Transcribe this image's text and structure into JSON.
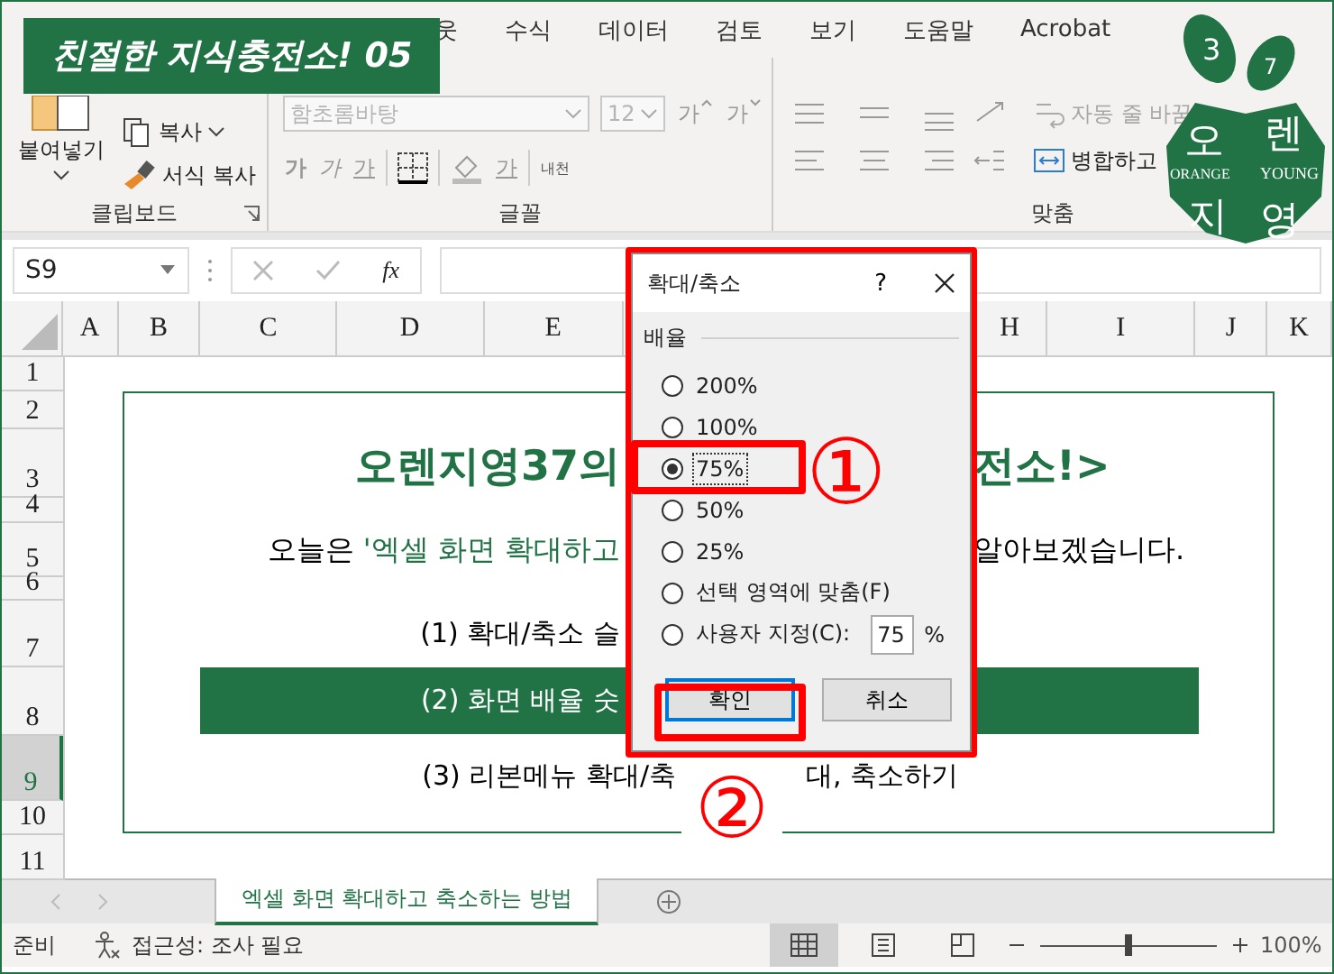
{
  "banner": {
    "text": "친절한 지식충전소! 05"
  },
  "ribbon_tabs": [
    {
      "label": "웃"
    },
    {
      "label": "수식"
    },
    {
      "label": "데이터"
    },
    {
      "label": "검토"
    },
    {
      "label": "보기"
    },
    {
      "label": "도움말"
    },
    {
      "label": "Acrobat"
    }
  ],
  "ribbon": {
    "clipboard": {
      "paste": "붙여넣기",
      "copy": {
        "label": "복사",
        "disabled": false
      },
      "format_painter": {
        "label": "서식 복사",
        "disabled": false
      },
      "group": "클립보드"
    },
    "font": {
      "font_name": {
        "label": "함초롬바탕",
        "disabled": true
      },
      "font_size": {
        "label": "12",
        "disabled": true
      },
      "grow": "가",
      "shrink": "가",
      "bold": "가",
      "italic": "가",
      "underline": "가",
      "font_color": "가",
      "phonetic": "내천",
      "group": "글꼴"
    },
    "alignment": {
      "wrap_text": {
        "label": "자동 줄 바꿈",
        "disabled": true
      },
      "merge": {
        "label": "병합하고",
        "disabled": false
      },
      "group": "맞춤"
    }
  },
  "logo": {
    "texts": [
      "3",
      "7",
      "오",
      "렌",
      "ORANGE",
      "YOUNG",
      "지",
      "영"
    ]
  },
  "formula_bar": {
    "name_box": "S9",
    "fx": "fx"
  },
  "columns": [
    {
      "label": "A"
    },
    {
      "label": "B"
    },
    {
      "label": "C"
    },
    {
      "label": "D"
    },
    {
      "label": "E"
    },
    {
      "label": "H"
    },
    {
      "label": "I"
    },
    {
      "label": "J"
    },
    {
      "label": "K"
    }
  ],
  "rows": [
    {
      "label": "1",
      "selected": false
    },
    {
      "label": "2",
      "selected": false
    },
    {
      "label": "3",
      "selected": false
    },
    {
      "label": "4",
      "selected": false
    },
    {
      "label": "5",
      "selected": false
    },
    {
      "label": "6",
      "selected": false
    },
    {
      "label": "7",
      "selected": false
    },
    {
      "label": "8",
      "selected": false
    },
    {
      "label": "9",
      "selected": true
    },
    {
      "label": "10",
      "selected": false
    },
    {
      "label": "11",
      "selected": false
    }
  ],
  "content": {
    "title_left": "오렌지영37의",
    "title_right": "전소!>",
    "intro_plain": "오늘은",
    "intro_quote": "'엑셀 화면 확대하고",
    "intro_right": "알아보겠습니다.",
    "items": [
      {
        "kind": "plain",
        "left": "(1) 확대/축소 슬"
      },
      {
        "kind": "highlight",
        "left": "(2) 화면 배율 숫"
      },
      {
        "kind": "plain",
        "left": "(3) 리본메뉴 확대/축",
        "right": "대, 축소하기"
      }
    ]
  },
  "dialog": {
    "title": "확대/축소",
    "help": "?",
    "group": "배율",
    "options": [
      {
        "kind": "preset",
        "label": "200%",
        "selected": false
      },
      {
        "kind": "preset",
        "label": "100%",
        "selected": false
      },
      {
        "kind": "preset",
        "label": "75%",
        "selected": true
      },
      {
        "kind": "preset",
        "label": "50%",
        "selected": false
      },
      {
        "kind": "preset",
        "label": "25%",
        "selected": false
      },
      {
        "kind": "preset",
        "label": "선택 영역에 맞춤(F)",
        "selected": false
      },
      {
        "kind": "custom",
        "label": "사용자 지정(C):",
        "selected": false
      }
    ],
    "custom_value": "75",
    "percent": "%",
    "ok": "확인",
    "cancel": "취소"
  },
  "annotations": [
    "①",
    "②"
  ],
  "sheet_tabs": [
    {
      "label": "엑셀 화면 확대하고 축소하는 방법",
      "selected": true
    }
  ],
  "status_bar": {
    "ready": "준비",
    "accessibility": "접근성: 조사 필요",
    "views": [
      {
        "kind": "normal",
        "selected": true
      },
      {
        "kind": "page_layout",
        "selected": false
      },
      {
        "kind": "page_break",
        "selected": false
      }
    ],
    "zoom_slider": {
      "level": 0.5
    },
    "zoom": "100%"
  }
}
